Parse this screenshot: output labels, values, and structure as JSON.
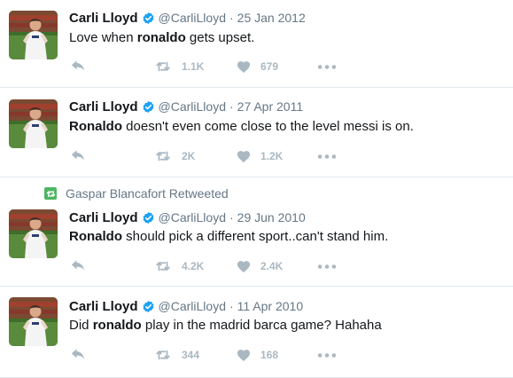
{
  "tweets": [
    {
      "name": "Carli Lloyd",
      "handle": "@CarliLloyd",
      "separator": "·",
      "date": "25 Jan 2012",
      "text_parts": [
        "Love when ",
        "ronaldo",
        " gets upset."
      ],
      "retweets": "1.1K",
      "likes": "679"
    },
    {
      "name": "Carli Lloyd",
      "handle": "@CarliLloyd",
      "separator": "·",
      "date": "27 Apr 2011",
      "text_parts": [
        "Ronaldo",
        " doesn't even come close to the level messi is on."
      ],
      "retweets": "2K",
      "likes": "1.2K"
    },
    {
      "retweeted_by": "Gaspar Blancafort Retweeted",
      "name": "Carli Lloyd",
      "handle": "@CarliLloyd",
      "separator": "·",
      "date": "29 Jun 2010",
      "text_parts": [
        "Ronaldo",
        " should pick a different sport..can't stand him."
      ],
      "retweets": "4.2K",
      "likes": "2.4K"
    },
    {
      "name": "Carli Lloyd",
      "handle": "@CarliLloyd",
      "separator": "·",
      "date": "11 Apr 2010",
      "text_parts": [
        "Did ",
        "ronaldo",
        " play in the madrid barca game? Hahaha"
      ],
      "retweets": "344",
      "likes": "168"
    }
  ],
  "icons": {
    "reply": "reply-icon",
    "retweet": "retweet-icon",
    "like": "heart-icon",
    "more": "more-icon",
    "verified": "verified-badge-icon",
    "retweet_context": "retweet-context-icon"
  },
  "colors": {
    "text": "#14171a",
    "muted": "#657786",
    "icon": "#aab8c2",
    "verified": "#1da1f2",
    "retweet_green": "#4eb562",
    "divider": "#e1e8ed"
  }
}
